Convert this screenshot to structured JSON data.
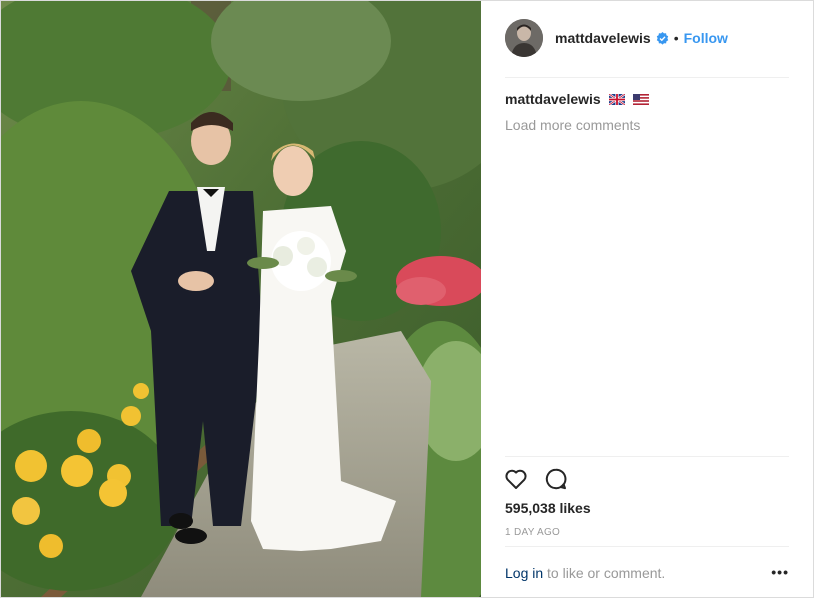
{
  "header": {
    "username": "mattdavelewis",
    "separator": "•",
    "follow_label": "Follow"
  },
  "caption": {
    "username": "mattdavelewis",
    "flags": [
      "uk-flag-icon",
      "us-flag-icon"
    ]
  },
  "comments": {
    "load_more_label": "Load more comments"
  },
  "stats": {
    "likes": "595,038 likes",
    "time_ago": "1 DAY AGO"
  },
  "footer": {
    "login_label": "Log in",
    "rest_text": " to like or comment.",
    "more_label": "•••"
  },
  "colors": {
    "accent": "#3897f0",
    "muted": "#999999",
    "text": "#262626",
    "border": "#dbdbdb"
  }
}
